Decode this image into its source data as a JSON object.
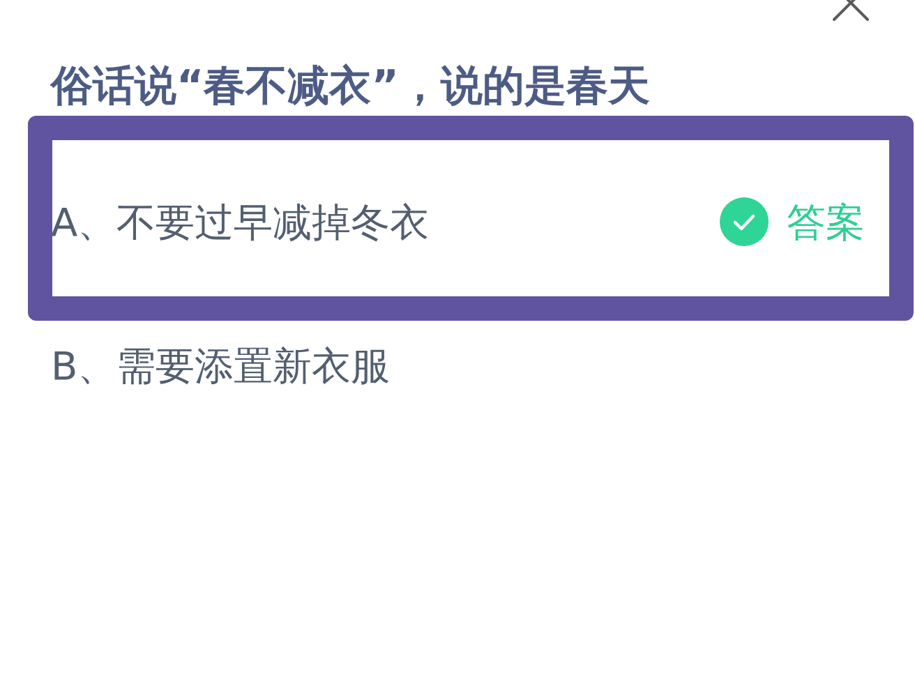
{
  "question": "俗话说“春不减衣”，说的是春天",
  "options": [
    {
      "text": "A、不要过早减掉冬衣",
      "highlighted": true,
      "answer_tag": "答案"
    },
    {
      "text": "B、需要添置新衣服",
      "highlighted": false
    }
  ]
}
